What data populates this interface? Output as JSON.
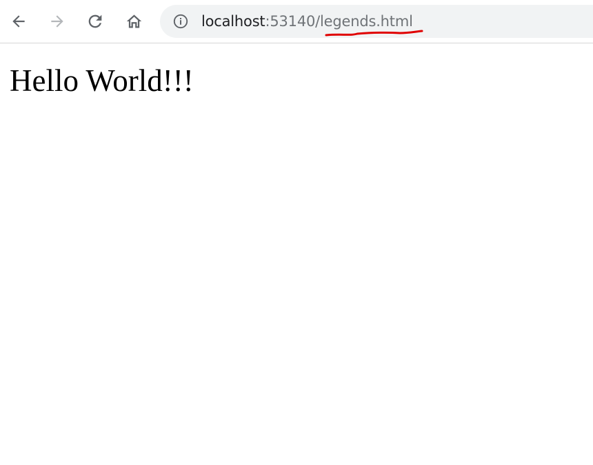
{
  "browser": {
    "toolbar": {
      "back_icon": "arrow-left-icon",
      "forward_icon": "arrow-right-icon",
      "reload_icon": "reload-icon",
      "home_icon": "home-icon"
    },
    "omnibox": {
      "security_icon": "info-circle-icon",
      "url_host": "localhost",
      "url_rest": ":53140/legends.html",
      "annotation_color": "#e00000"
    }
  },
  "page": {
    "heading": "Hello World!!!"
  },
  "colors": {
    "omnibox_bg": "#f1f3f4",
    "icon_active": "#5f6368",
    "icon_disabled": "#b4b7ba",
    "url_muted": "#6f7377"
  }
}
